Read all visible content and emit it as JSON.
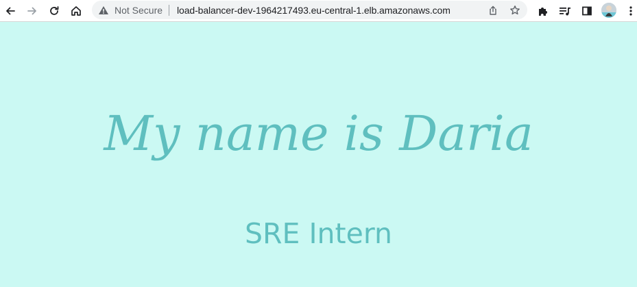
{
  "browser": {
    "security_status": "Not Secure",
    "url": "load-balancer-dev-1964217493.eu-central-1.elb.amazonaws.com",
    "icons": {
      "back": "back-arrow-icon",
      "forward": "forward-arrow-icon",
      "reload": "reload-icon",
      "home": "home-icon",
      "warning": "warning-triangle-icon",
      "share": "share-icon",
      "bookmark": "star-icon",
      "extensions": "puzzle-icon",
      "media": "media-control-icon",
      "side_panel": "side-panel-icon",
      "profile": "avatar",
      "menu": "kebab-menu-icon"
    }
  },
  "page": {
    "headline": "My name is Daria",
    "subheadline": "SRE Intern",
    "colors": {
      "background": "#cbf9f3",
      "text": "#5fbfbf"
    }
  }
}
